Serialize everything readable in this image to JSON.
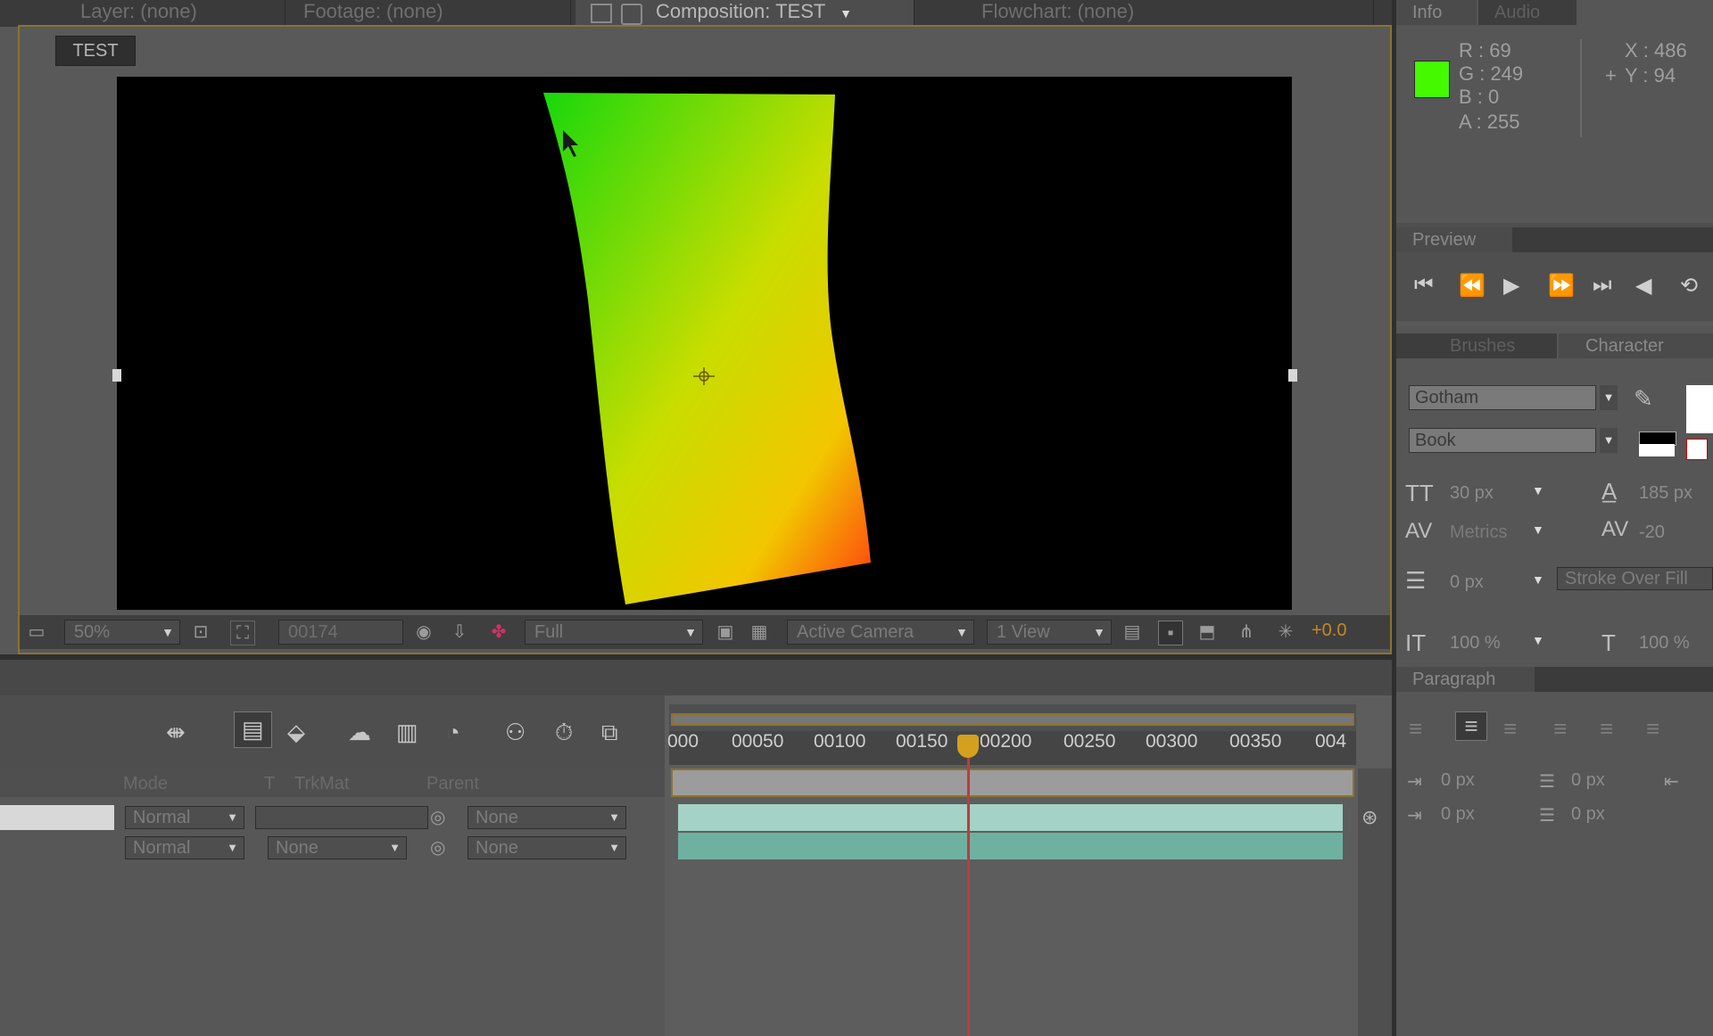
{
  "tabs": [
    {
      "label": "Layer: (none)",
      "active": false
    },
    {
      "label": "Footage: (none)",
      "active": false
    },
    {
      "label": "Composition: TEST",
      "active": true
    },
    {
      "label": "Flowchart: (none)",
      "active": false
    }
  ],
  "viewer": {
    "comp_label": "TEST",
    "toolbar": {
      "zoom": "50%",
      "timecode": "00174",
      "resolution": "Full",
      "camera": "Active Camera",
      "views": "1 View",
      "exposure": "+0.0"
    }
  },
  "info": {
    "tabs": [
      "Info",
      "Audio"
    ],
    "R": "R : 69",
    "G": "G : 249",
    "B": "B : 0",
    "A": "A : 255",
    "X": "X : 486",
    "Y": "Y : 94",
    "swatch_color": "#45f900"
  },
  "preview": {
    "tab": "Preview"
  },
  "character": {
    "tabs": [
      "Brushes",
      "Character"
    ],
    "font": "Gotham",
    "style": "Book",
    "size": "30 px",
    "leading": "185 px",
    "kerning": "Metrics",
    "tracking": "-20",
    "stroke_width": "0 px",
    "stroke_type": "Stroke Over Fill",
    "vscale": "100 %",
    "hscale": "100 %"
  },
  "paragraph": {
    "tab": "Paragraph",
    "indent_left": "0 px",
    "indent_first": "0 px",
    "space_before": "0 px",
    "space_after": "0 px"
  },
  "timeline": {
    "columns": {
      "mode": "Mode",
      "trkmat": "T",
      "trkmat2": "TrkMat",
      "parent": "Parent"
    },
    "ruler": [
      "000",
      "00050",
      "00100",
      "00150",
      "00200",
      "00250",
      "00300",
      "00350",
      "004"
    ],
    "layers": [
      {
        "mode": "Normal",
        "trkmat": "",
        "parent": "None"
      },
      {
        "mode": "Normal",
        "trkmat": "None",
        "parent": "None"
      }
    ]
  }
}
